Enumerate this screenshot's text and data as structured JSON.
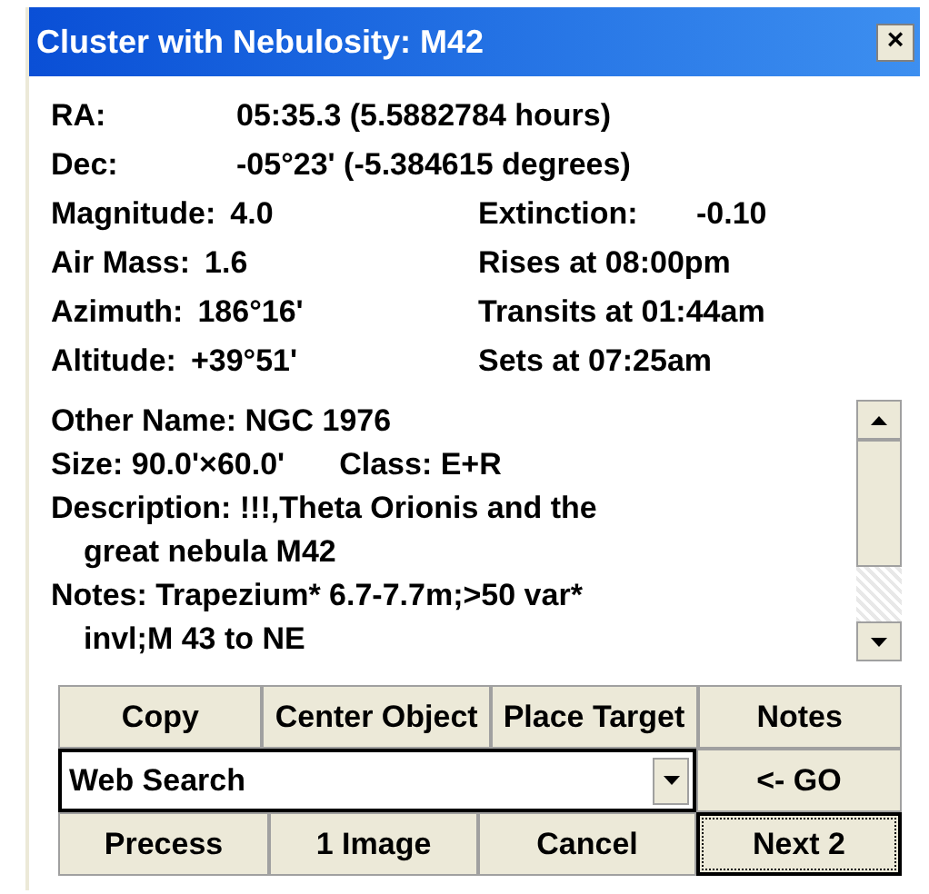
{
  "window": {
    "title": "Cluster with Nebulosity: M42",
    "close": "×"
  },
  "info_rows": [
    {
      "label": "RA:",
      "value": "05:35.3 (5.5882784 hours)"
    },
    {
      "label": "Dec:",
      "value": "-05°23' (-5.384615 degrees)"
    }
  ],
  "details_rows": [
    {
      "left_label": "Magnitude:",
      "left_value": "4.0",
      "right_label": "Extinction:",
      "right_value": "-0.10"
    },
    {
      "left_label": "Air Mass:",
      "left_value": "1.6",
      "right_text": "Rises at 08:00pm"
    },
    {
      "left_label": "Azimuth:",
      "left_value": "186°16'",
      "right_text": "Transits at 01:44am"
    },
    {
      "left_label": "Altitude:",
      "left_value": "+39°51'",
      "right_text": "Sets at 07:25am"
    }
  ],
  "notes_box": {
    "paragraphs": [
      {
        "lines": [
          "Other Name: NGC 1976"
        ]
      },
      {
        "lines": [
          "Size: 90.0'×60.0'"
        ],
        "extra": "Class: E+R"
      },
      {
        "lines": [
          "Description: !!!,Theta Orionis and the",
          "great nebula M42"
        ]
      },
      {
        "lines": [
          "Notes: Trapezium* 6.7-7.7m;>50 var*",
          "invl;M 43 to NE"
        ]
      }
    ]
  },
  "action_buttons": [
    {
      "label": "Copy"
    },
    {
      "label": "Center Object"
    },
    {
      "label": "Place Target"
    },
    {
      "label": "Notes"
    }
  ],
  "search": {
    "value": "Web Search",
    "go_label": "<- GO"
  },
  "bottom_buttons": [
    {
      "label": "Precess",
      "focused": false
    },
    {
      "label": "1 Image",
      "focused": false
    },
    {
      "label": "Cancel",
      "focused": false
    },
    {
      "label": "Next 2",
      "focused": true
    }
  ]
}
